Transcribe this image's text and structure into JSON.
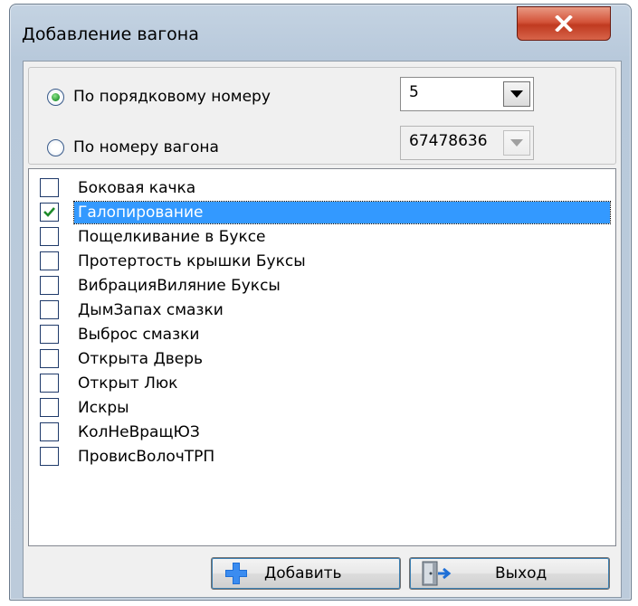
{
  "window": {
    "title": "Добавление вагона"
  },
  "selection": {
    "by_order_label": "По порядковому номеру",
    "by_order_value": "5",
    "by_order_checked": true,
    "by_number_label": "По номеру вагона",
    "by_number_value": "67478636",
    "by_number_checked": false
  },
  "items": [
    {
      "label": "Боковая качка",
      "checked": false
    },
    {
      "label": "Галопирование",
      "checked": true,
      "selected": true
    },
    {
      "label": "Пощелкивание в Буксе",
      "checked": false
    },
    {
      "label": "Протертость крышки Буксы",
      "checked": false
    },
    {
      "label": "ВибрацияВиляние Буксы",
      "checked": false
    },
    {
      "label": "ДымЗапах смазки",
      "checked": false
    },
    {
      "label": "Выброс смазки",
      "checked": false
    },
    {
      "label": "Открыта Дверь",
      "checked": false
    },
    {
      "label": "Открыт Люк",
      "checked": false
    },
    {
      "label": "Искры",
      "checked": false
    },
    {
      "label": "КолНеВращЮЗ",
      "checked": false
    },
    {
      "label": "ПровисВолочТРП",
      "checked": false
    }
  ],
  "buttons": {
    "add": "Добавить",
    "exit": "Выход"
  },
  "colors": {
    "selection": "#3399ff",
    "close": "#c03a20",
    "add_icon": "#1f6fd6"
  }
}
